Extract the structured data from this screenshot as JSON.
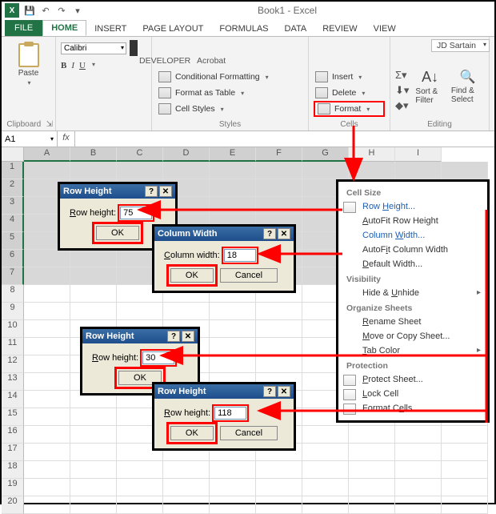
{
  "window": {
    "title": "Book1 - Excel"
  },
  "tabs": {
    "file": "FILE",
    "home": "HOME",
    "insert": "INSERT",
    "page_layout": "PAGE LAYOUT",
    "formulas": "FORMULAS",
    "data": "DATA",
    "review": "REVIEW",
    "view": "VIEW",
    "developer": "DEVELOPER",
    "acrobat": "Acrobat"
  },
  "user": "JD Sartain",
  "ribbon": {
    "clipboard": {
      "paste": "Paste",
      "group": "Clipboard"
    },
    "font": {
      "name": "Calibri",
      "bold": "B",
      "italic": "I",
      "underline": "U"
    },
    "styles": {
      "cond_fmt": "Conditional Formatting",
      "format_table": "Format as Table",
      "cell_styles": "Cell Styles",
      "group": "Styles"
    },
    "cells": {
      "insert": "Insert",
      "delete": "Delete",
      "format": "Format",
      "group": "Cells"
    },
    "editing": {
      "sort_filter": "Sort & Filter",
      "find_select": "Find & Select",
      "group": "Editing"
    }
  },
  "namebox": "A1",
  "columns": [
    "A",
    "B",
    "C",
    "D",
    "E",
    "F",
    "G",
    "H",
    "I"
  ],
  "rows": [
    "1",
    "2",
    "3",
    "4",
    "5",
    "6",
    "7",
    "8",
    "9",
    "10",
    "11",
    "12",
    "13",
    "14",
    "15",
    "16",
    "17",
    "18",
    "19",
    "20"
  ],
  "dialogs": {
    "row_height_1": {
      "title": "Row Height",
      "label": "Row height:",
      "value": "75",
      "ok": "OK"
    },
    "column_width": {
      "title": "Column Width",
      "label": "Column width:",
      "value": "18",
      "ok": "OK",
      "cancel": "Cancel"
    },
    "row_height_2": {
      "title": "Row Height",
      "label": "Row height:",
      "value": "30",
      "ok": "OK"
    },
    "row_height_3": {
      "title": "Row Height",
      "label": "Row height:",
      "value": "118",
      "ok": "OK",
      "cancel": "Cancel"
    }
  },
  "menu": {
    "sec_cell_size": "Cell Size",
    "row_height": "Row Height...",
    "autofit_row": "AutoFit Row Height",
    "col_width": "Column Width...",
    "autofit_col": "AutoFit Column Width",
    "default_width": "Default Width...",
    "sec_visibility": "Visibility",
    "hide_unhide": "Hide & Unhide",
    "sec_organize": "Organize Sheets",
    "rename": "Rename Sheet",
    "move_copy": "Move or Copy Sheet...",
    "tab_color": "Tab Color",
    "sec_protection": "Protection",
    "protect_sheet": "Protect Sheet...",
    "lock_cell": "Lock Cell",
    "format_cells": "Format Cells..."
  }
}
